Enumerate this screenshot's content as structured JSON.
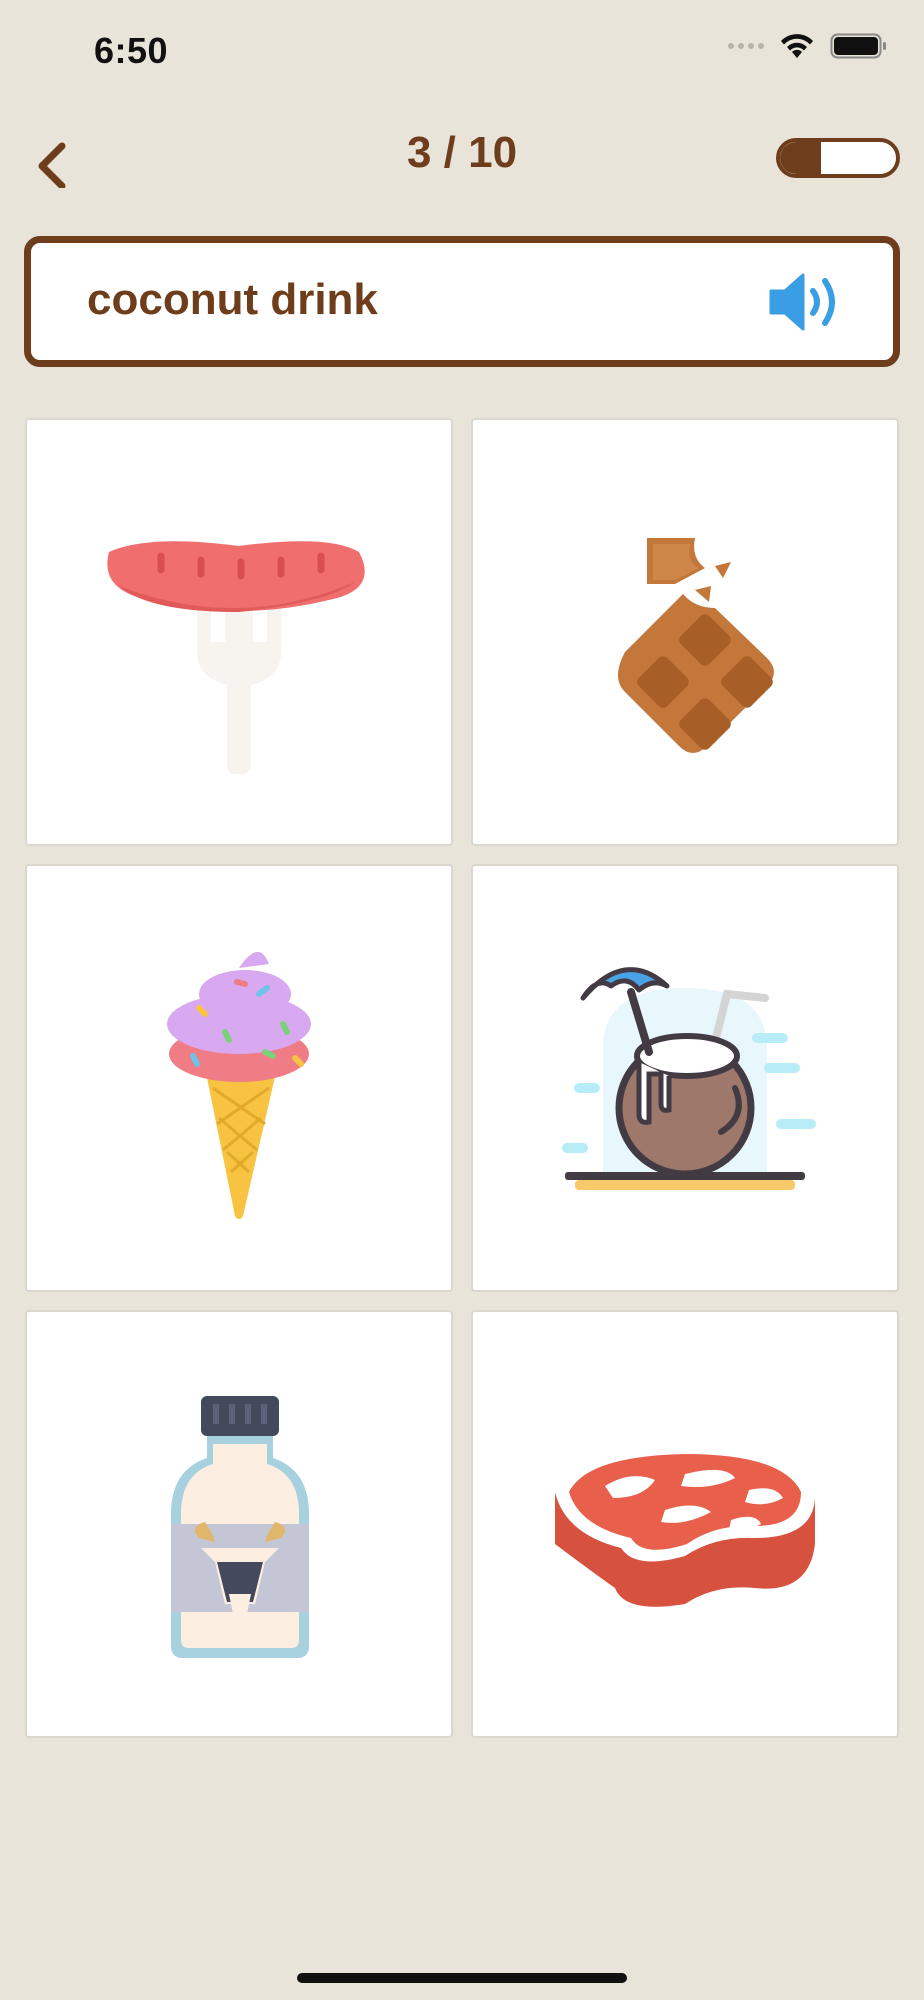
{
  "status_bar": {
    "time": "6:50"
  },
  "nav": {
    "progress": "3 / 10",
    "sound_toggle_level": 0.35
  },
  "prompt": {
    "text": "coconut drink"
  },
  "options": [
    {
      "icon": "sausage-on-fork-icon"
    },
    {
      "icon": "chocolate-bar-icon"
    },
    {
      "icon": "ice-cream-cone-icon"
    },
    {
      "icon": "coconut-drink-icon"
    },
    {
      "icon": "goat-milk-bottle-icon"
    },
    {
      "icon": "steak-icon"
    }
  ],
  "colors": {
    "background": "#e9e4da",
    "accent": "#6e3d1c",
    "speaker": "#3a9ee4",
    "tile_border": "#dcd7ce"
  }
}
